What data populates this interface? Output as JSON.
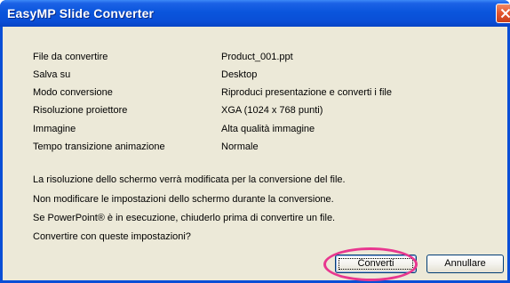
{
  "window": {
    "title": "EasyMP Slide Converter"
  },
  "settings": [
    {
      "label": "File da convertire",
      "value": "Product_001.ppt"
    },
    {
      "label": "Salva su",
      "value": "Desktop"
    },
    {
      "label": "Modo conversione",
      "value": "Riproduci presentazione e converti i file"
    },
    {
      "label": "Risoluzione proiettore",
      "value": "XGA (1024 x 768 punti)"
    },
    {
      "label": "Immagine",
      "value": "Alta qualità immagine"
    },
    {
      "label": "Tempo transizione animazione",
      "value": "Normale"
    }
  ],
  "messages": [
    "La risoluzione dello schermo verrà modificata per la conversione del file.",
    "Non modificare le impostazioni dello schermo durante la conversione.",
    "Se PowerPoint® è in esecuzione, chiuderlo prima di convertire un file.",
    "Convertire con queste impostazioni?"
  ],
  "buttons": {
    "convert_label": "Converti",
    "cancel_label": "Annullare"
  },
  "colors": {
    "titlebar": "#0a4ed6",
    "dialog_bg": "#ece9d8",
    "highlight_ring": "#e8378f",
    "close_button": "#e2542c"
  },
  "icons": {
    "close": "close-icon"
  }
}
